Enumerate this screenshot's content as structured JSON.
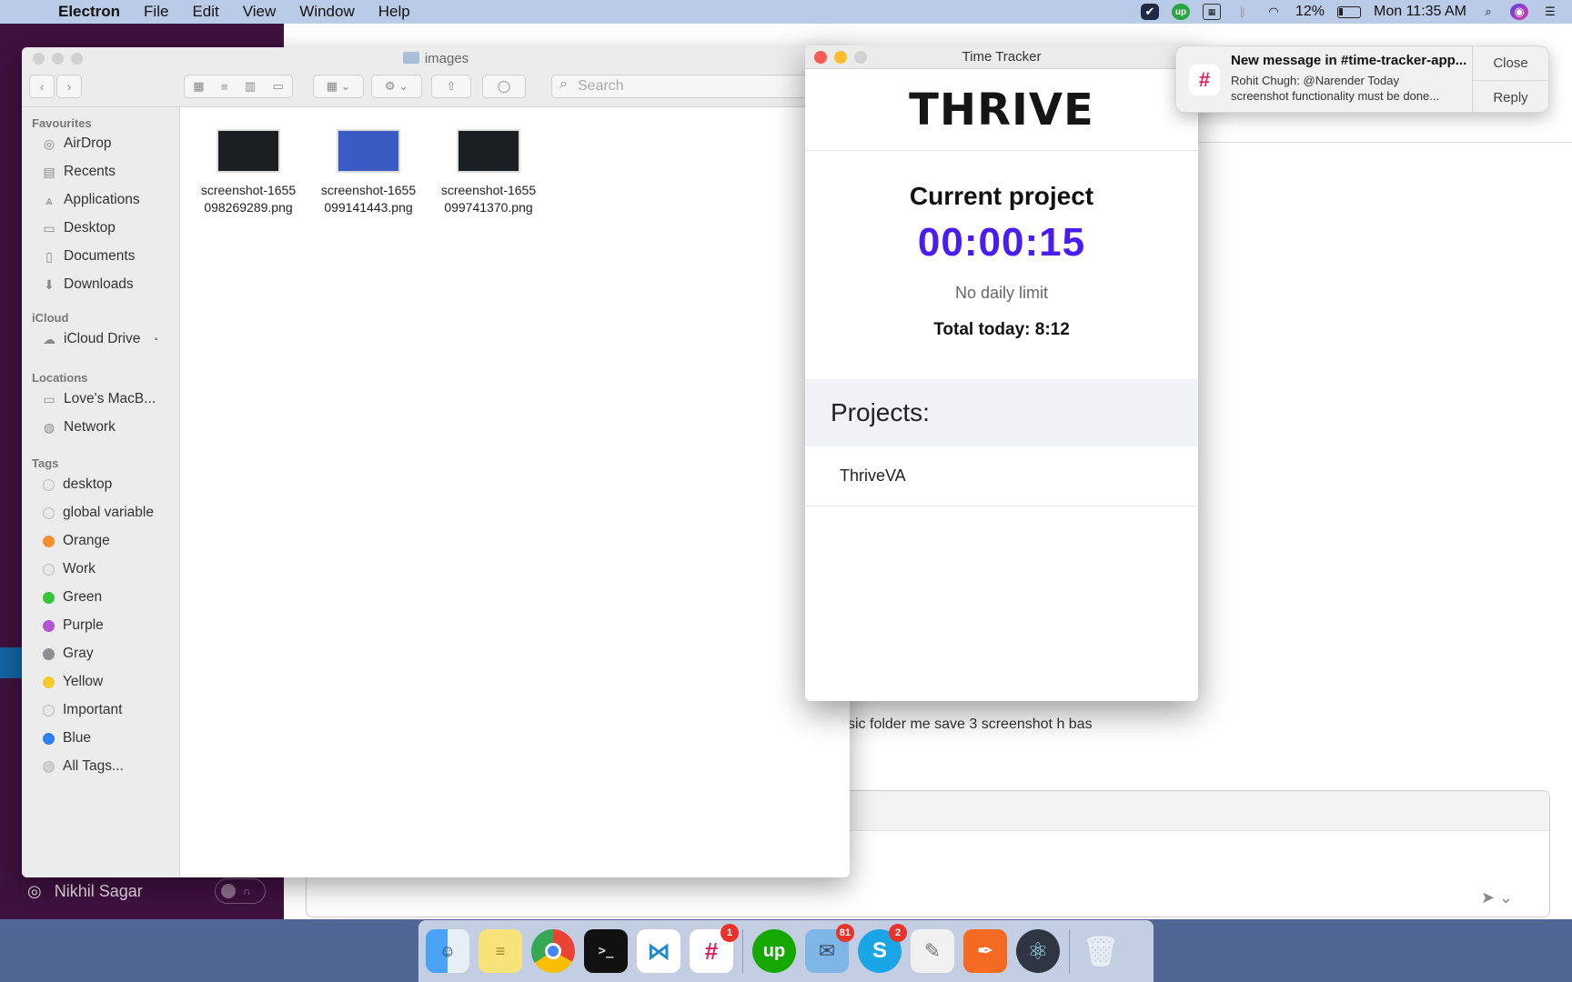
{
  "menubar": {
    "app_name": "Electron",
    "items": [
      "File",
      "Edit",
      "View",
      "Window",
      "Help"
    ],
    "battery": "12%",
    "clock": "Mon 11:35 AM"
  },
  "slack": {
    "user_name": "Nikhil Sagar",
    "message_fragment": "sic folder me save 3 screenshot h bas"
  },
  "finder": {
    "title": "images",
    "search_placeholder": "Search",
    "sections": {
      "favourites": "Favourites",
      "icloud": "iCloud",
      "locations": "Locations",
      "tags": "Tags"
    },
    "favourites": [
      "AirDrop",
      "Recents",
      "Applications",
      "Desktop",
      "Documents",
      "Downloads"
    ],
    "icloud": [
      "iCloud Drive"
    ],
    "locations": [
      "Love's MacB...",
      "Network"
    ],
    "tags": [
      {
        "label": "desktop",
        "color": "#e8e8e8"
      },
      {
        "label": "global variable",
        "color": "#e8e8e8"
      },
      {
        "label": "Orange",
        "color": "#f5902c"
      },
      {
        "label": "Work",
        "color": "#e8e8e8"
      },
      {
        "label": "Green",
        "color": "#35c43a"
      },
      {
        "label": "Purple",
        "color": "#b455d6"
      },
      {
        "label": "Gray",
        "color": "#8e8e93"
      },
      {
        "label": "Yellow",
        "color": "#f8c92b"
      },
      {
        "label": "Important",
        "color": "#e8e8e8"
      },
      {
        "label": "Blue",
        "color": "#2d7ff2"
      },
      {
        "label": "All Tags...",
        "color": "#d0d0d0"
      }
    ],
    "files": [
      {
        "line1": "screenshot-1655",
        "line2": "098269289.png"
      },
      {
        "line1": "screenshot-1655",
        "line2": "099141443.png"
      },
      {
        "line1": "screenshot-1655",
        "line2": "099741370.png"
      }
    ]
  },
  "tracker": {
    "window_title": "Time Tracker",
    "logo": "THRIVE",
    "heading": "Current project",
    "timer": "00:00:15",
    "limit": "No daily limit",
    "total": "Total today: 8:12",
    "projects_label": "Projects:",
    "projects": [
      "ThriveVA"
    ],
    "accent_color": "#4a1cf2"
  },
  "notification": {
    "title": "New message in #time-tracker-app...",
    "body_line1": "Rohit Chugh: @Narender Today",
    "body_line2": "screenshot functionality must be done...",
    "close": "Close",
    "reply": "Reply"
  },
  "dock": {
    "badges": {
      "slack": "1",
      "mail": "81",
      "skype": "2"
    }
  }
}
